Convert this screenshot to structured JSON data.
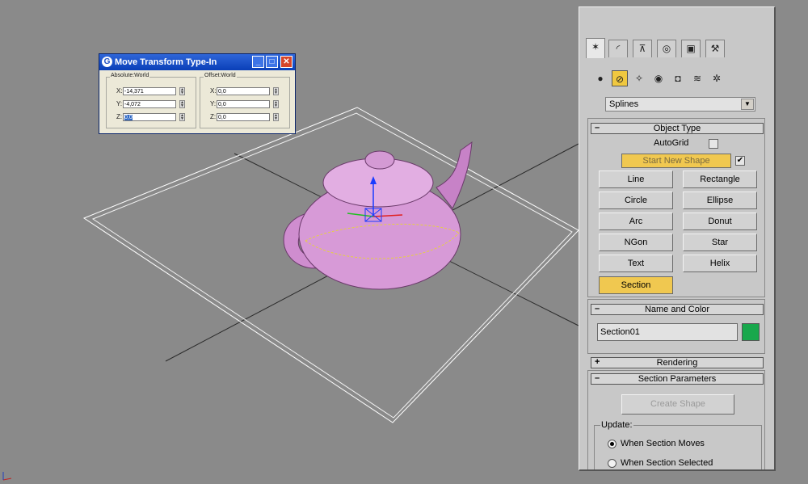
{
  "dialog": {
    "title": "Move Transform Type-In",
    "app_icon": "G",
    "minimize": "_",
    "maximize": "□",
    "close": "✕",
    "absolute": {
      "label": "Absolute:World",
      "x": "-14,371",
      "y": "-4,072",
      "z": "0,0"
    },
    "offset": {
      "label": "Offset:World",
      "x": "0,0",
      "y": "0,0",
      "z": "0,0"
    },
    "x_label": "X:",
    "y_label": "Y:",
    "z_label": "Z:"
  },
  "panel": {
    "tabs": [
      "create-icon",
      "modify-icon",
      "hierarchy-icon",
      "motion-icon",
      "display-icon",
      "utilities-icon"
    ],
    "tab_glyphs": [
      "✶",
      "◜",
      "⊼",
      "◎",
      "▣",
      "⚒"
    ],
    "subcategories": [
      "geometry-icon",
      "shapes-icon",
      "lights-icon",
      "cameras-icon",
      "helpers-icon",
      "spacewarps-icon",
      "systems-icon"
    ],
    "sub_glyphs": [
      "●",
      "⊘",
      "✧",
      "◉",
      "◘",
      "≋",
      "✲"
    ],
    "category_dropdown": "Splines",
    "object_type": {
      "header": "Object Type",
      "toggle": "–",
      "autogrid_label": "AutoGrid",
      "start_new_shape": "Start New Shape",
      "start_new_shape_checked": "✔",
      "buttons": [
        "Line",
        "Rectangle",
        "Circle",
        "Ellipse",
        "Arc",
        "Donut",
        "NGon",
        "Star",
        "Text",
        "Helix",
        "Section"
      ]
    },
    "name_and_color": {
      "header": "Name and Color",
      "toggle": "–",
      "name": "Section01",
      "color": "#18a84c"
    },
    "rendering": {
      "header": "Rendering",
      "toggle": "+"
    },
    "section_parameters": {
      "header": "Section Parameters",
      "toggle": "–",
      "create_shape": "Create Shape",
      "update_label": "Update:",
      "option1": "When Section Moves",
      "option2": "When Section Selected"
    }
  },
  "colors": {
    "viewport_bg": "#8a8a8a",
    "teapot": "#d89ad8",
    "grid_lines": "#ffffff",
    "active_button": "#f0c850",
    "section_outline": "#e6d040"
  }
}
